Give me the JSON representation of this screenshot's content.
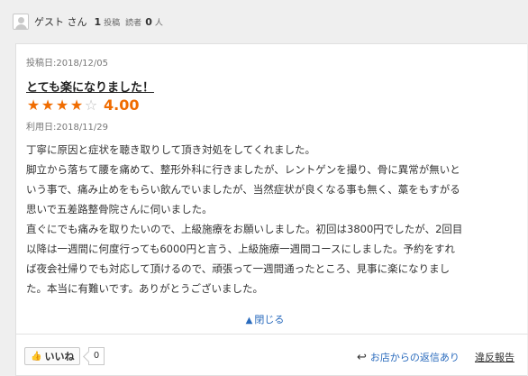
{
  "reviewer": {
    "name": "ゲスト さん",
    "posts_count": "1",
    "posts_label": "投稿",
    "readers_label": "読者",
    "readers_count": "0",
    "readers_unit": "人"
  },
  "review": {
    "posted_date": "投稿日:2018/12/05",
    "title": "とても楽になりました！",
    "rating": 4,
    "rating_max": 5,
    "score": "4.00",
    "visit_date": "利用日:2018/11/29",
    "body_lines": [
      "丁寧に原因と症状を聴き取りして頂き対処をしてくれました。",
      "脚立から落ちて腰を痛めて、整形外科に行きましたが、レントゲンを撮り、骨に異常が無いと",
      "いう事で、痛み止めをもらい飲んでいましたが、当然症状が良くなる事も無く、藁をもすがる",
      "思いで五差路整骨院さんに伺いました。",
      "直ぐにでも痛みを取りたいので、上級施療をお願いしました。初回は3800円でしたが、2回目",
      "以降は一週間に何度行っても6000円と言う、上級施療一週間コースにしました。予約をすれ",
      "ば夜会社帰りでも対応して頂けるので、頑張って一週間通ったところ、見事に楽になりまし",
      "た。本当に有難いです。ありがとうございました。"
    ],
    "close_label": "閉じる"
  },
  "actions": {
    "like_label": "いいね",
    "like_count": "0",
    "reply_label": "お店からの返信あり",
    "report_label": "違反報告"
  },
  "icons": {
    "avatar": "user-avatar-icon",
    "star": "star-icon",
    "close": "up-arrow-icon",
    "like": "thumbs-up-icon",
    "reply": "reply-arrow-icon"
  },
  "colors": {
    "accent": "#f06c00",
    "link": "#2a6bbd",
    "background": "#efefef"
  }
}
